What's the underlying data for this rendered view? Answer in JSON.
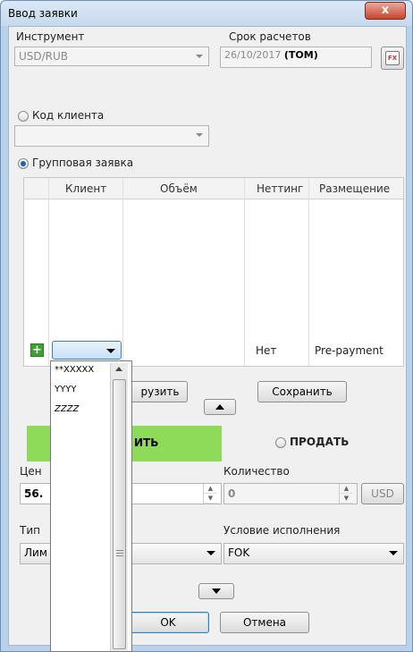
{
  "window": {
    "title": "Ввод заявки",
    "close_glyph": "x"
  },
  "instrument": {
    "label": "Инструмент",
    "value": "USD/RUB"
  },
  "settlement": {
    "label": "Срок расчетов",
    "date": "26/10/2017",
    "term": "(TOM)",
    "calendar_icon": "calendar-fx-icon",
    "calendar_text": "FX"
  },
  "client_code": {
    "label": "Код клиента"
  },
  "group_order": {
    "label": "Групповая заявка"
  },
  "table": {
    "headers": [
      "Клиент",
      "Объём",
      "Неттинг",
      "Размещение"
    ],
    "new_row": {
      "add_icon": "+",
      "netting": "Нет",
      "placement": "Pre-payment"
    }
  },
  "dropdown": {
    "items": [
      "**XXXXX",
      "YYYY",
      "ZZZZ"
    ]
  },
  "buttons": {
    "load": "рузить",
    "save": "Сохранить",
    "ok": "OK",
    "cancel": "Отмена",
    "expand_up": "▲",
    "expand_down": "▼"
  },
  "side": {
    "buy_label": "ИТЬ",
    "sell_label": "ПРОДАТЬ",
    "buy_color": "#8edb5a"
  },
  "price": {
    "label": "Цен",
    "value": "56."
  },
  "quantity": {
    "label": "Количество",
    "value": "0",
    "currency": "USD"
  },
  "order_type": {
    "label": "Тип",
    "value": "Лим"
  },
  "exec_condition": {
    "label": "Условие исполнения",
    "value": "FOK"
  }
}
